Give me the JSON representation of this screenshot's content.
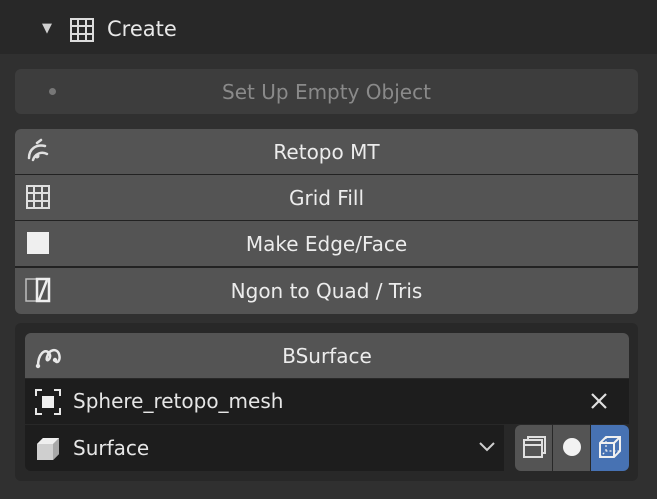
{
  "header": {
    "title": "Create",
    "expanded_icon": "triangle-down-icon",
    "section_icon": "grid-fill-icon"
  },
  "setup_empty_button": {
    "label": "Set Up Empty Object",
    "enabled": false
  },
  "tools": [
    {
      "label": "Retopo MT",
      "icon": "retopo-icon"
    },
    {
      "label": "Grid Fill",
      "icon": "grid-fill-icon"
    },
    {
      "label": "Make Edge/Face",
      "icon": "square-face-icon"
    },
    {
      "label": "Ngon to Quad / Tris",
      "icon": "ngon-quad-icon"
    }
  ],
  "bsurface": {
    "label": "BSurface",
    "icon": "bsurface-curve-icon",
    "object_field": {
      "value": "Sphere_retopo_mesh",
      "icon": "object-icon"
    },
    "mode_dropdown": {
      "value": "Surface",
      "icon": "surface-icon"
    },
    "display_modes": [
      {
        "name": "wireframe-display",
        "active": false
      },
      {
        "name": "solid-display",
        "active": false
      },
      {
        "name": "xray-display",
        "active": true
      }
    ]
  },
  "colors": {
    "accent": "#4772b3",
    "button": "#545454",
    "field": "#1d1d1d",
    "background": "#303030"
  }
}
